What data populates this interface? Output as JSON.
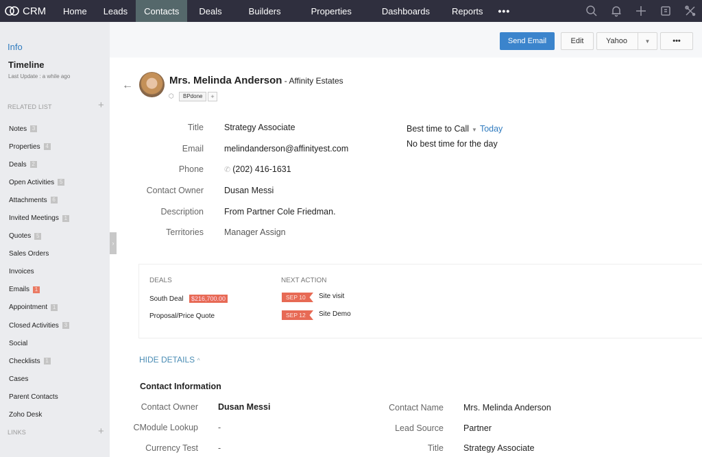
{
  "app": {
    "logo_text": "CRM",
    "nav": [
      {
        "label": "Home",
        "active": false
      },
      {
        "label": "Leads",
        "active": false
      },
      {
        "label": "Contacts",
        "active": true
      },
      {
        "label": "Deals",
        "active": false
      },
      {
        "label": "Builders",
        "active": false
      },
      {
        "label": "Properties",
        "active": false
      },
      {
        "label": "Dashboards",
        "active": false
      },
      {
        "label": "Reports",
        "active": false
      }
    ],
    "nav_more": "•••",
    "top_icons": [
      "search-icon",
      "bell-icon",
      "plus-icon",
      "calendar-icon",
      "tools-icon"
    ]
  },
  "sidebar": {
    "info_label": "Info",
    "timeline_label": "Timeline",
    "last_update": "Last Update : a while ago",
    "related_list_header": "RELATED LIST",
    "links_header": "LINKS",
    "items": [
      {
        "label": "Notes",
        "count": "3"
      },
      {
        "label": "Properties",
        "count": "4"
      },
      {
        "label": "Deals",
        "count": "2"
      },
      {
        "label": "Open Activities",
        "count": "5"
      },
      {
        "label": "Attachments",
        "count": "6"
      },
      {
        "label": "Invited Meetings",
        "count": "1"
      },
      {
        "label": "Quotes",
        "count": "5"
      },
      {
        "label": "Sales Orders",
        "count": null
      },
      {
        "label": "Invoices",
        "count": null
      },
      {
        "label": "Emails",
        "count": "1",
        "highlight": true
      },
      {
        "label": "Appointment",
        "count": "1"
      },
      {
        "label": "Closed Activities",
        "count": "3"
      },
      {
        "label": "Social",
        "count": null
      },
      {
        "label": "Checklists",
        "count": "1"
      },
      {
        "label": "Cases",
        "count": null
      },
      {
        "label": "Parent Contacts",
        "count": null
      },
      {
        "label": "Zoho Desk",
        "count": null
      }
    ]
  },
  "actions": {
    "send_email": "Send Email",
    "edit": "Edit",
    "dropdown_value": "Yahoo",
    "more": "•••"
  },
  "contact": {
    "name": "Mrs. Melinda Anderson",
    "company_sep": " - ",
    "company": "Affinity Estates",
    "tag": "BPdone",
    "tag_add": "+",
    "fields": [
      {
        "label": "Title",
        "value": "Strategy Associate"
      },
      {
        "label": "Email",
        "value": "melindanderson@affinityest.com"
      },
      {
        "label": "Phone",
        "value": "(202) 416-1631"
      },
      {
        "label": "Contact Owner",
        "value": "Dusan Messi"
      },
      {
        "label": "Description",
        "value": "From Partner Cole Friedman."
      },
      {
        "label": "Territories",
        "value": "Manager Assign"
      }
    ],
    "best_time": {
      "label": "Best time to Call",
      "day": "Today",
      "note": "No best time for the day"
    }
  },
  "deals_panel": {
    "deals_header": "DEALS",
    "next_action_header": "NEXT ACTION",
    "deals": [
      {
        "name": "South Deal",
        "amount": "$216,700.00"
      },
      {
        "name": "Proposal/Price Quote",
        "amount": null
      }
    ],
    "actions": [
      {
        "date": "SEP 10",
        "label": "Site visit"
      },
      {
        "date": "SEP 12",
        "label": "Site Demo"
      }
    ]
  },
  "details": {
    "toggle_label": "HIDE DETAILS",
    "section_title": "Contact Information",
    "left": [
      {
        "label": "Contact Owner",
        "value": "Dusan Messi"
      },
      {
        "label": "CModule Lookup",
        "value": "-"
      },
      {
        "label": "Currency Test",
        "value": "-"
      }
    ],
    "right": [
      {
        "label": "Contact Name",
        "value": "Mrs. Melinda Anderson"
      },
      {
        "label": "Lead Source",
        "value": "Partner"
      },
      {
        "label": "Title",
        "value": "Strategy Associate"
      }
    ]
  },
  "colors": {
    "topbar": "#2f2f3e",
    "active_tab": "#55686b",
    "primary_button": "#3b84cc",
    "accent_link": "#2f7bbf",
    "deal_badge": "#e76a55"
  }
}
